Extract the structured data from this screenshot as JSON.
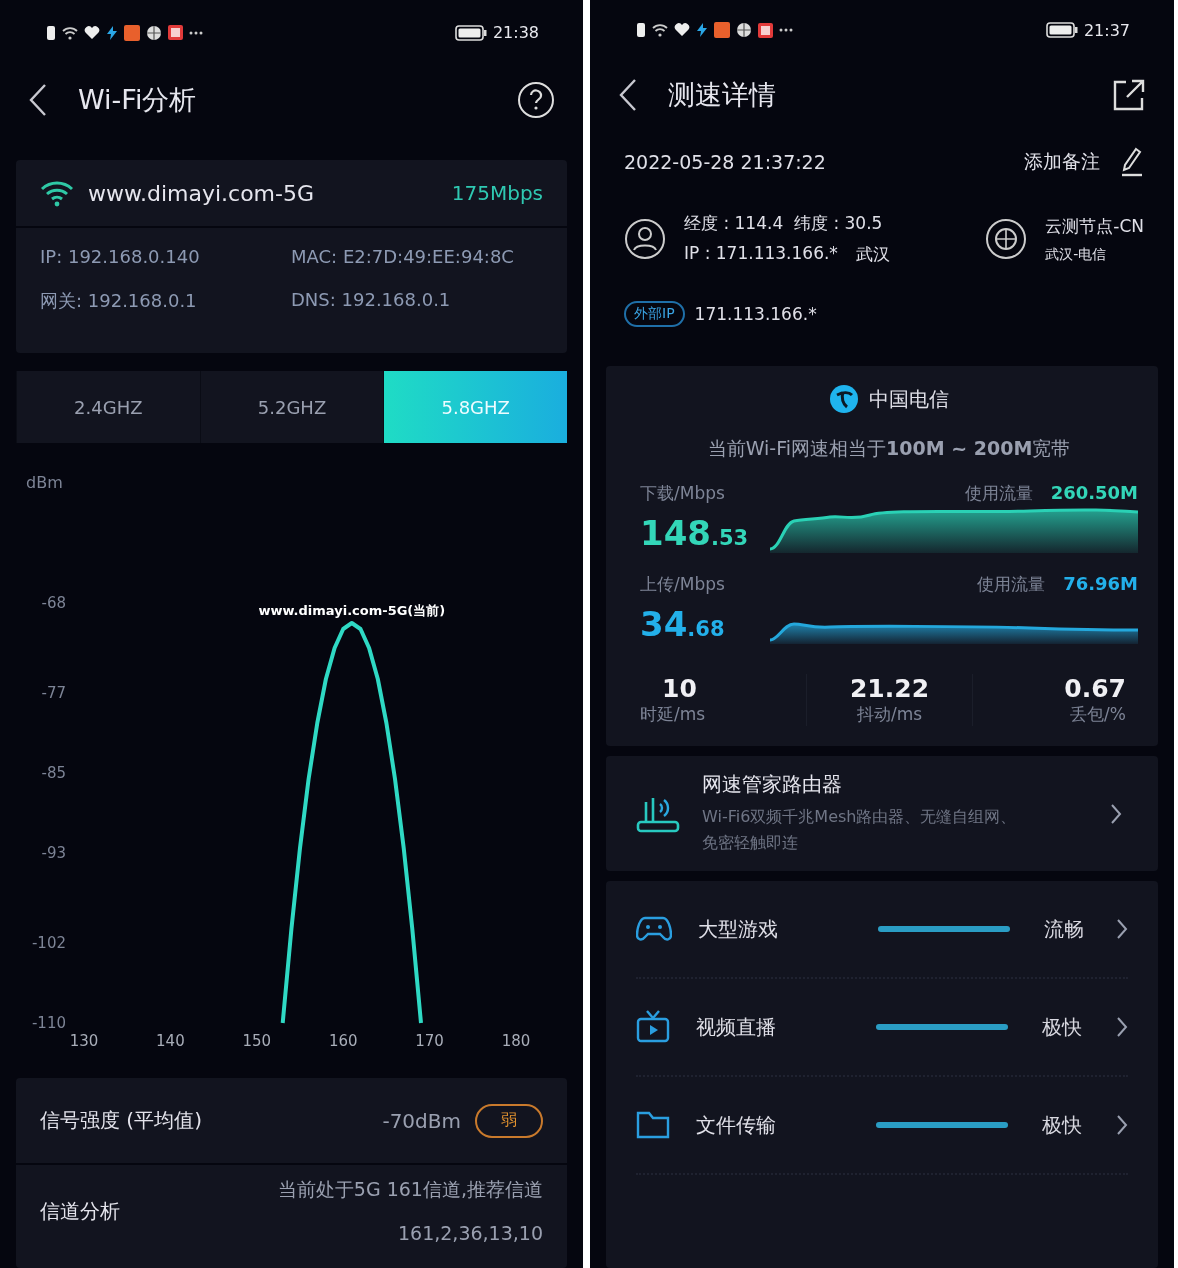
{
  "wifi_analysis": {
    "status_bar": {
      "time": "21:38"
    },
    "title": "Wi-Fi分析",
    "network": {
      "ssid": "www.dimayi.com-5G",
      "speed": "175Mbps",
      "details": [
        "IP: 192.168.0.140",
        "MAC: E2:7D:49:EE:94:8C",
        "网关: 192.168.0.1",
        "DNS: 192.168.0.1"
      ]
    },
    "bands": [
      {
        "label": "2.4GHZ",
        "selected": false
      },
      {
        "label": "5.2GHZ",
        "selected": false
      },
      {
        "label": "5.8GHZ",
        "selected": true
      }
    ],
    "chart": {
      "chart_data": {
        "type": "line",
        "annotations": [
          {
            "text": "dBm"
          }
        ],
        "x": [
          153,
          154,
          155,
          156,
          157,
          158,
          159,
          160,
          161,
          162,
          163,
          164,
          165,
          166,
          167,
          168,
          169
        ],
        "series": [
          {
            "name": "www.dimayi.com-5G(当前)",
            "color": "#2fd9c4",
            "values": [
              -110,
              -100.6,
              -92.5,
              -85.6,
              -80,
              -75.6,
              -72.5,
              -70.6,
              -70,
              -70.6,
              -72.5,
              -75.6,
              -80,
              -85.6,
              -92.5,
              -100.6,
              -110
            ]
          }
        ],
        "xlim": [
          130,
          180
        ],
        "ylim": [
          -110,
          -68
        ],
        "xticks": [
          130,
          140,
          150,
          160,
          170,
          180
        ],
        "yticks": [
          -68,
          -77,
          -85,
          -93,
          -102,
          -110
        ]
      }
    },
    "signal": {
      "label": "信号强度 (平均值)",
      "value": "-70dBm",
      "badge": "弱"
    },
    "channel": {
      "label": "信道分析",
      "lines": [
        "当前处于5G 161信道,推荐信道",
        "161,2,36,13,10"
      ]
    }
  },
  "speed_test": {
    "status_bar": {
      "time": "21:37"
    },
    "title": "测速详情",
    "datetime": "2022-05-28 21:37:22",
    "note_action": "添加备注",
    "location": {
      "coords": "经度 : 114.4  纬度 : 30.5",
      "ip": "IP : 171.113.166.*",
      "city": "武汉"
    },
    "node": {
      "name": "云测节点-CN",
      "isp": "武汉-电信"
    },
    "external_ip": {
      "badge": "外部IP",
      "value": "171.113.166.*"
    },
    "carrier": "中国电信",
    "summary": "当前Wi-Fi网速相当于**100M ~ 200M**宽带",
    "download": {
      "label": "下载/Mbps",
      "usage_label": "使用流量",
      "usage": "260.50M",
      "value": "148",
      "decimal": ".53"
    },
    "upload": {
      "label": "上传/Mbps",
      "usage_label": "使用流量",
      "usage": "76.96M",
      "value": "34",
      "decimal": ".68"
    },
    "stats": [
      {
        "value": "10",
        "label": "时延/ms"
      },
      {
        "value": "21.22",
        "label": "抖动/ms"
      },
      {
        "value": "0.67",
        "label": "丢包/%"
      }
    ],
    "router": {
      "title": "网速管家路由器",
      "description": "Wi-Fi6双频千兆Mesh路由器、无缝自组网、免密轻触即连"
    },
    "scenarios": [
      {
        "kind": "game",
        "name": "大型游戏",
        "level": 1,
        "status": "流畅"
      },
      {
        "kind": "video",
        "name": "视频直播",
        "level": 1,
        "status": "极快"
      },
      {
        "kind": "file",
        "name": "文件传输",
        "level": 1,
        "status": "极快"
      }
    ]
  }
}
